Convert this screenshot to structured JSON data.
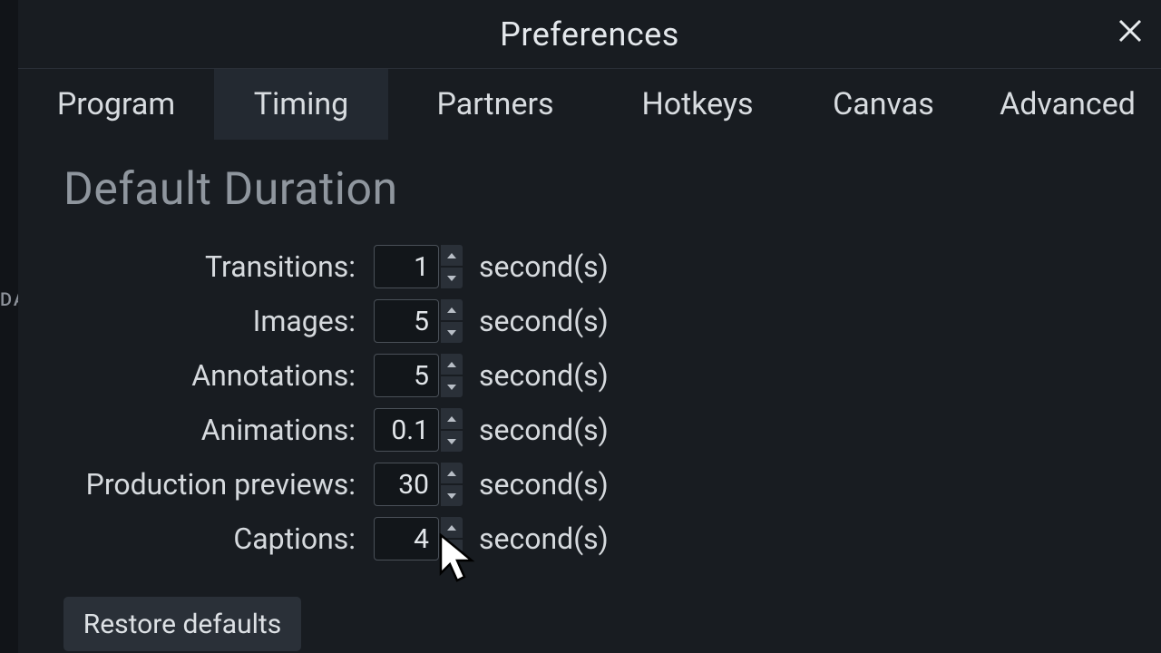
{
  "dialog": {
    "title": "Preferences"
  },
  "tabs": {
    "program": "Program",
    "timing": "Timing",
    "partners": "Partners",
    "hotkeys": "Hotkeys",
    "canvas": "Canvas",
    "advanced": "Advanced"
  },
  "section": {
    "heading": "Default Duration",
    "unit": "second(s)"
  },
  "fields": {
    "transitions": {
      "label": "Transitions:",
      "value": "1"
    },
    "images": {
      "label": "Images:",
      "value": "5"
    },
    "annotations": {
      "label": "Annotations:",
      "value": "5"
    },
    "animations": {
      "label": "Animations:",
      "value": "0.1"
    },
    "production_previews": {
      "label": "Production previews:",
      "value": "30"
    },
    "captions": {
      "label": "Captions:",
      "value": "4"
    }
  },
  "buttons": {
    "restore_defaults": "Restore defaults"
  },
  "backdrop": {
    "partial": "DA"
  }
}
